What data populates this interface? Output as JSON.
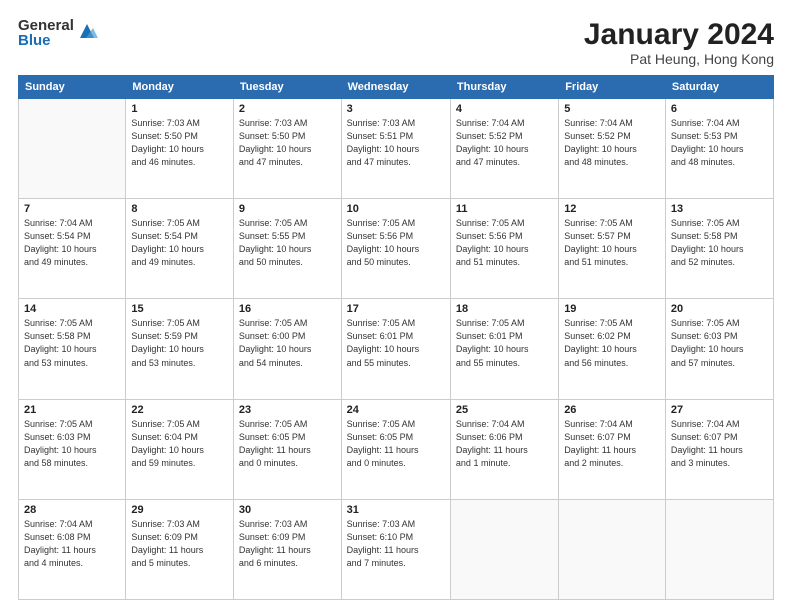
{
  "logo": {
    "general": "General",
    "blue": "Blue"
  },
  "header": {
    "month": "January 2024",
    "location": "Pat Heung, Hong Kong"
  },
  "days_of_week": [
    "Sunday",
    "Monday",
    "Tuesday",
    "Wednesday",
    "Thursday",
    "Friday",
    "Saturday"
  ],
  "weeks": [
    [
      {
        "day": "",
        "info": ""
      },
      {
        "day": "1",
        "info": "Sunrise: 7:03 AM\nSunset: 5:50 PM\nDaylight: 10 hours\nand 46 minutes."
      },
      {
        "day": "2",
        "info": "Sunrise: 7:03 AM\nSunset: 5:50 PM\nDaylight: 10 hours\nand 47 minutes."
      },
      {
        "day": "3",
        "info": "Sunrise: 7:03 AM\nSunset: 5:51 PM\nDaylight: 10 hours\nand 47 minutes."
      },
      {
        "day": "4",
        "info": "Sunrise: 7:04 AM\nSunset: 5:52 PM\nDaylight: 10 hours\nand 47 minutes."
      },
      {
        "day": "5",
        "info": "Sunrise: 7:04 AM\nSunset: 5:52 PM\nDaylight: 10 hours\nand 48 minutes."
      },
      {
        "day": "6",
        "info": "Sunrise: 7:04 AM\nSunset: 5:53 PM\nDaylight: 10 hours\nand 48 minutes."
      }
    ],
    [
      {
        "day": "7",
        "info": "Sunrise: 7:04 AM\nSunset: 5:54 PM\nDaylight: 10 hours\nand 49 minutes."
      },
      {
        "day": "8",
        "info": "Sunrise: 7:05 AM\nSunset: 5:54 PM\nDaylight: 10 hours\nand 49 minutes."
      },
      {
        "day": "9",
        "info": "Sunrise: 7:05 AM\nSunset: 5:55 PM\nDaylight: 10 hours\nand 50 minutes."
      },
      {
        "day": "10",
        "info": "Sunrise: 7:05 AM\nSunset: 5:56 PM\nDaylight: 10 hours\nand 50 minutes."
      },
      {
        "day": "11",
        "info": "Sunrise: 7:05 AM\nSunset: 5:56 PM\nDaylight: 10 hours\nand 51 minutes."
      },
      {
        "day": "12",
        "info": "Sunrise: 7:05 AM\nSunset: 5:57 PM\nDaylight: 10 hours\nand 51 minutes."
      },
      {
        "day": "13",
        "info": "Sunrise: 7:05 AM\nSunset: 5:58 PM\nDaylight: 10 hours\nand 52 minutes."
      }
    ],
    [
      {
        "day": "14",
        "info": "Sunrise: 7:05 AM\nSunset: 5:58 PM\nDaylight: 10 hours\nand 53 minutes."
      },
      {
        "day": "15",
        "info": "Sunrise: 7:05 AM\nSunset: 5:59 PM\nDaylight: 10 hours\nand 53 minutes."
      },
      {
        "day": "16",
        "info": "Sunrise: 7:05 AM\nSunset: 6:00 PM\nDaylight: 10 hours\nand 54 minutes."
      },
      {
        "day": "17",
        "info": "Sunrise: 7:05 AM\nSunset: 6:01 PM\nDaylight: 10 hours\nand 55 minutes."
      },
      {
        "day": "18",
        "info": "Sunrise: 7:05 AM\nSunset: 6:01 PM\nDaylight: 10 hours\nand 55 minutes."
      },
      {
        "day": "19",
        "info": "Sunrise: 7:05 AM\nSunset: 6:02 PM\nDaylight: 10 hours\nand 56 minutes."
      },
      {
        "day": "20",
        "info": "Sunrise: 7:05 AM\nSunset: 6:03 PM\nDaylight: 10 hours\nand 57 minutes."
      }
    ],
    [
      {
        "day": "21",
        "info": "Sunrise: 7:05 AM\nSunset: 6:03 PM\nDaylight: 10 hours\nand 58 minutes."
      },
      {
        "day": "22",
        "info": "Sunrise: 7:05 AM\nSunset: 6:04 PM\nDaylight: 10 hours\nand 59 minutes."
      },
      {
        "day": "23",
        "info": "Sunrise: 7:05 AM\nSunset: 6:05 PM\nDaylight: 11 hours\nand 0 minutes."
      },
      {
        "day": "24",
        "info": "Sunrise: 7:05 AM\nSunset: 6:05 PM\nDaylight: 11 hours\nand 0 minutes."
      },
      {
        "day": "25",
        "info": "Sunrise: 7:04 AM\nSunset: 6:06 PM\nDaylight: 11 hours\nand 1 minute."
      },
      {
        "day": "26",
        "info": "Sunrise: 7:04 AM\nSunset: 6:07 PM\nDaylight: 11 hours\nand 2 minutes."
      },
      {
        "day": "27",
        "info": "Sunrise: 7:04 AM\nSunset: 6:07 PM\nDaylight: 11 hours\nand 3 minutes."
      }
    ],
    [
      {
        "day": "28",
        "info": "Sunrise: 7:04 AM\nSunset: 6:08 PM\nDaylight: 11 hours\nand 4 minutes."
      },
      {
        "day": "29",
        "info": "Sunrise: 7:03 AM\nSunset: 6:09 PM\nDaylight: 11 hours\nand 5 minutes."
      },
      {
        "day": "30",
        "info": "Sunrise: 7:03 AM\nSunset: 6:09 PM\nDaylight: 11 hours\nand 6 minutes."
      },
      {
        "day": "31",
        "info": "Sunrise: 7:03 AM\nSunset: 6:10 PM\nDaylight: 11 hours\nand 7 minutes."
      },
      {
        "day": "",
        "info": ""
      },
      {
        "day": "",
        "info": ""
      },
      {
        "day": "",
        "info": ""
      }
    ]
  ]
}
